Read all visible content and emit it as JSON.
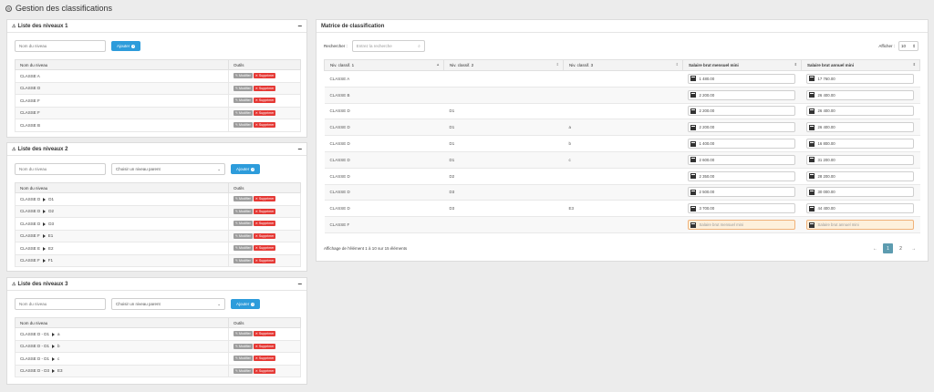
{
  "header": {
    "title": "Gestion des classifications",
    "icon": "settings-icon"
  },
  "level1": {
    "title": "Liste des niveaux 1",
    "name_placeholder": "Nom du niveau",
    "add_label": "Ajouter",
    "col_name": "Nom du niveau",
    "col_tools": "Outils",
    "rows": [
      "CLASSE A",
      "CLASSE D",
      "CLASSE F",
      "CLASSE F",
      "CLASSE B"
    ]
  },
  "level2": {
    "title": "Liste des niveaux 2",
    "name_placeholder": "Nom du niveau",
    "parent_placeholder": "Choisir un niveau parent",
    "add_label": "Ajouter",
    "col_name": "Nom du niveau",
    "col_tools": "Outils",
    "rows": [
      {
        "parent": "CLASSE D",
        "child": "D1"
      },
      {
        "parent": "CLASSE D",
        "child": "D2"
      },
      {
        "parent": "CLASSE D",
        "child": "D3"
      },
      {
        "parent": "CLASSE F",
        "child": "E1"
      },
      {
        "parent": "CLASSE E",
        "child": "E2"
      },
      {
        "parent": "CLASSE F",
        "child": "F1"
      }
    ]
  },
  "level3": {
    "title": "Liste des niveaux 3",
    "name_placeholder": "Nom du niveau",
    "parent_placeholder": "Choisir un niveau parent",
    "add_label": "Ajouter",
    "col_name": "Nom du niveau",
    "col_tools": "Outils",
    "rows": [
      {
        "a": "CLASSE D",
        "b": "D1",
        "c": "a"
      },
      {
        "a": "CLASSE D",
        "b": "D1",
        "c": "b"
      },
      {
        "a": "CLASSE D",
        "b": "D1",
        "c": "c"
      },
      {
        "a": "CLASSE D",
        "b": "D3",
        "c": "E3"
      }
    ]
  },
  "tools": {
    "edit": "Modifier",
    "delete": "Supprimer"
  },
  "matrix": {
    "title": "Matrice de classification",
    "search_label": "Rechercher :",
    "search_placeholder": "Entrez la recherche",
    "show_label": "Afficher :",
    "show_value": "10",
    "columns": [
      "Niv. classif. 1",
      "Niv. classif. 2",
      "Niv. classif. 3",
      "Salaire brut mensuel mini",
      "Salaire brut annuel mini"
    ],
    "rows": [
      {
        "c1": "CLASSE A",
        "c2": "",
        "c3": "",
        "m": "1 480.00",
        "a": "17 760.00"
      },
      {
        "c1": "CLASSE B",
        "c2": "",
        "c3": "",
        "m": "2 200.00",
        "a": "26 400.00"
      },
      {
        "c1": "CLASSE D",
        "c2": "D1",
        "c3": "",
        "m": "2 200.00",
        "a": "26 400.00"
      },
      {
        "c1": "CLASSE D",
        "c2": "D1",
        "c3": "a",
        "m": "2 200.00",
        "a": "26 400.00"
      },
      {
        "c1": "CLASSE D",
        "c2": "D1",
        "c3": "b",
        "m": "1 400.00",
        "a": "16 800.00"
      },
      {
        "c1": "CLASSE D",
        "c2": "D1",
        "c3": "c",
        "m": "2 600.00",
        "a": "31 200.00"
      },
      {
        "c1": "CLASSE D",
        "c2": "D2",
        "c3": "",
        "m": "2 350.00",
        "a": "28 200.00"
      },
      {
        "c1": "CLASSE D",
        "c2": "D3",
        "c3": "",
        "m": "2 500.00",
        "a": "30 000.00"
      },
      {
        "c1": "CLASSE D",
        "c2": "D3",
        "c3": "E3",
        "m": "3 700.00",
        "a": "44 400.00"
      },
      {
        "c1": "CLASSE F",
        "c2": "",
        "c3": "",
        "m": "",
        "a": ""
      }
    ],
    "monthly_placeholder": "Salaire brut mensuel mini",
    "annual_placeholder": "Salaire brut annuel mini",
    "info": "Affichage de l'élément 1 à 10 sur 15 éléments",
    "pager": {
      "prev": "←",
      "pages": [
        "1",
        "2"
      ],
      "next": "→"
    }
  }
}
